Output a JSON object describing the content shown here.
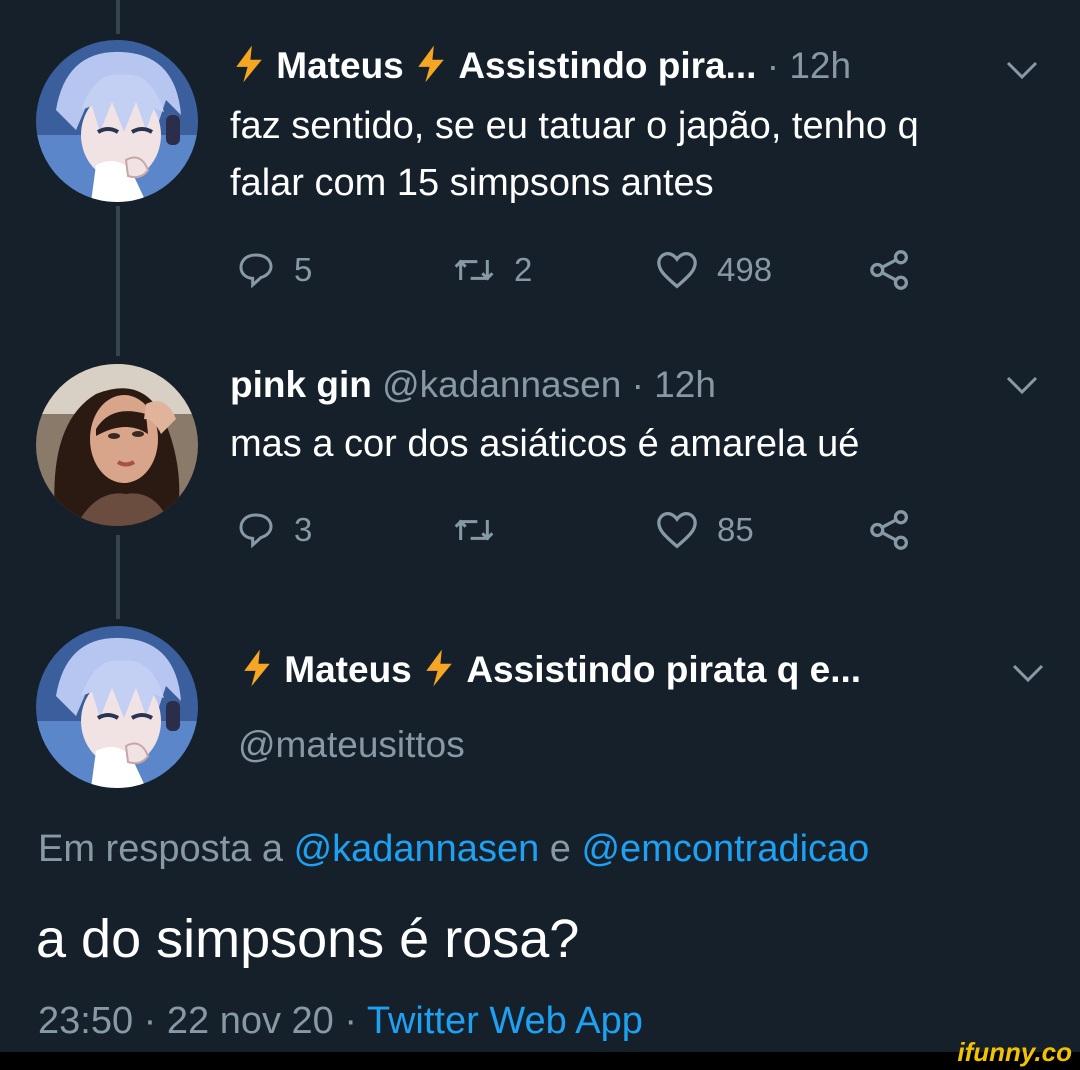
{
  "tweet1": {
    "display_name": "Mateus",
    "display_suffix": "Assistindo pira...",
    "time": "· 12h",
    "text_line1": "faz sentido, se eu tatuar o japão, tenho q",
    "text_line2": "falar com 15 simpsons antes",
    "replies": "5",
    "retweets": "2",
    "likes": "498"
  },
  "tweet2": {
    "display_name": "pink gin",
    "handle": "@kadannasen",
    "time": "· 12h",
    "text": "mas a cor dos asiáticos é amarela ué",
    "replies": "3",
    "retweets": "",
    "likes": "85"
  },
  "tweet3": {
    "display_name": "Mateus",
    "display_suffix": "Assistindo pirata q e...",
    "handle": "@mateusittos",
    "reply_prefix": "Em resposta a",
    "reply_user1": "@kadannasen",
    "reply_and": "e",
    "reply_user2": "@emcontradicao",
    "text": "a do simpsons é rosa?",
    "timestamp": "23:50 · 22 nov 20 ·",
    "source": "Twitter Web App"
  },
  "watermark": "ifunny.co",
  "colors": {
    "background": "#15202b",
    "muted": "#8899a6",
    "link": "#1da1f2",
    "bolt": "#f5a623"
  }
}
